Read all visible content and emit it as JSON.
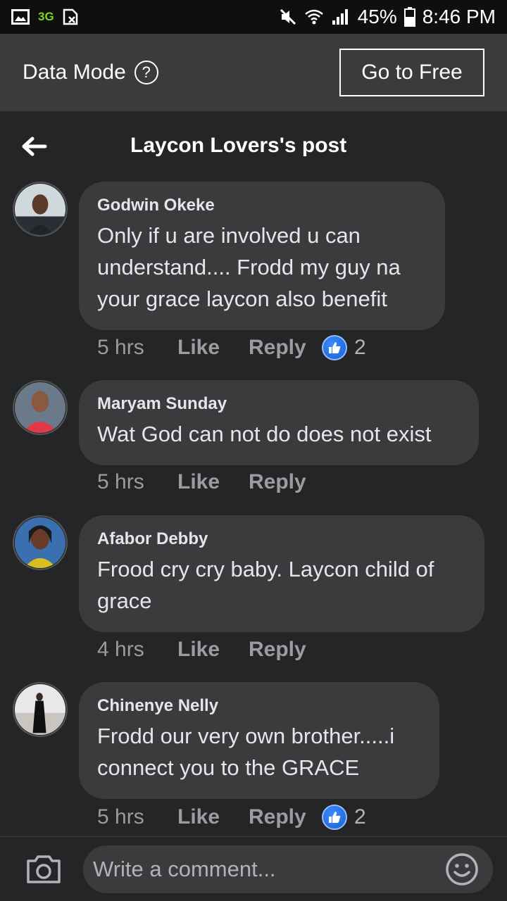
{
  "status_bar": {
    "network": "3G",
    "battery": "45%",
    "time": "8:46 PM",
    "icons": [
      "image-icon",
      "sim-icon",
      "mute-icon",
      "wifi-icon",
      "signal-icon",
      "battery-icon"
    ]
  },
  "data_mode": {
    "label": "Data Mode",
    "help": "?",
    "go_free": "Go to Free"
  },
  "header": {
    "title": "Laycon Lovers's post"
  },
  "comments": [
    {
      "author": "Godwin Okeke",
      "text": "Only if u are involved u can understand.... Frodd my guy na your grace laycon also benefit",
      "time": "5 hrs",
      "like": "Like",
      "reply": "Reply",
      "reactions": "2"
    },
    {
      "author": "Maryam Sunday",
      "text": "Wat God can not do does not exist",
      "time": "5 hrs",
      "like": "Like",
      "reply": "Reply"
    },
    {
      "author": "Afabor Debby",
      "text": "Frood cry cry baby. Laycon child of grace",
      "time": "4 hrs",
      "like": "Like",
      "reply": "Reply"
    },
    {
      "author": "Chinenye Nelly",
      "text": "Frodd our very own brother.....i connect you to the GRACE",
      "time": "5 hrs",
      "like": "Like",
      "reply": "Reply",
      "reactions": "2"
    }
  ],
  "composer": {
    "placeholder": "Write a comment..."
  },
  "colors": {
    "background": "#242526",
    "bubble": "#3a3b3c",
    "like_blue": "#1877f2"
  }
}
